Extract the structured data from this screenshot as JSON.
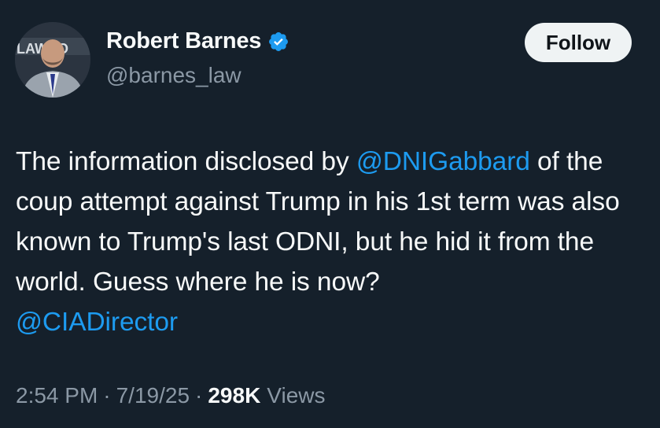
{
  "author": {
    "name": "Robert Barnes",
    "handle": "@barnes_law",
    "avatar_backdrop_text": "LAWYO",
    "verified": true,
    "verified_color": "#1d9bf0"
  },
  "follow_label": "Follow",
  "tweet": {
    "line1_pre": "The information disclosed by ",
    "mention1": "@DNIGabbard",
    "line1_post": " of",
    "body": "the coup attempt against Trump in his 1st term was also known to Trump's last ODNI, but he hid it from the world. Guess where he is now?",
    "mention2": "@CIADirector"
  },
  "meta": {
    "time": "2:54 PM",
    "date": "7/19/25",
    "views_count": "298K",
    "views_label": "Views"
  },
  "colors": {
    "background": "#15202b",
    "mention": "#1d9bf0",
    "secondary_text": "#8b98a5"
  }
}
